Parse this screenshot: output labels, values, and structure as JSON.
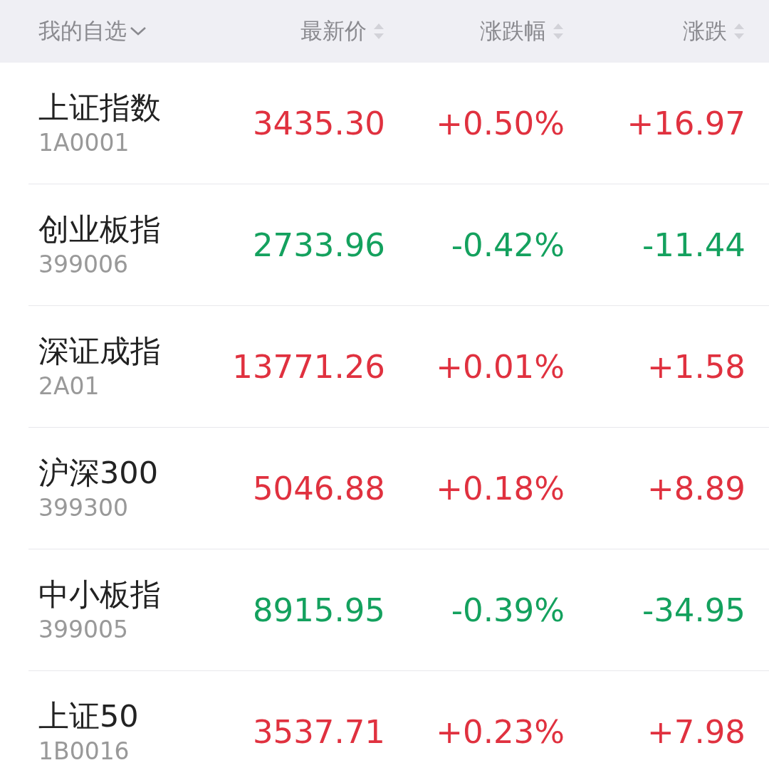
{
  "header": {
    "title": "我的自选",
    "columns": [
      "最新价",
      "涨跌幅",
      "涨跌"
    ]
  },
  "rows": [
    {
      "name": "上证指数",
      "code": "1A0001",
      "price": "3435.30",
      "percent": "+0.50%",
      "change": "+16.97",
      "color": "#e0313f"
    },
    {
      "name": "创业板指",
      "code": "399006",
      "price": "2733.96",
      "percent": "-0.42%",
      "change": "-11.44",
      "color": "#14a15e"
    },
    {
      "name": "深证成指",
      "code": "2A01",
      "price": "13771.26",
      "percent": "+0.01%",
      "change": "+1.58",
      "color": "#e0313f"
    },
    {
      "name": "沪深300",
      "code": "399300",
      "price": "5046.88",
      "percent": "+0.18%",
      "change": "+8.89",
      "color": "#e0313f"
    },
    {
      "name": "中小板指",
      "code": "399005",
      "price": "8915.95",
      "percent": "-0.39%",
      "change": "-34.95",
      "color": "#14a15e"
    },
    {
      "name": "上证50",
      "code": "1B0016",
      "price": "3537.71",
      "percent": "+0.23%",
      "change": "+7.98",
      "color": "#e0313f"
    }
  ]
}
